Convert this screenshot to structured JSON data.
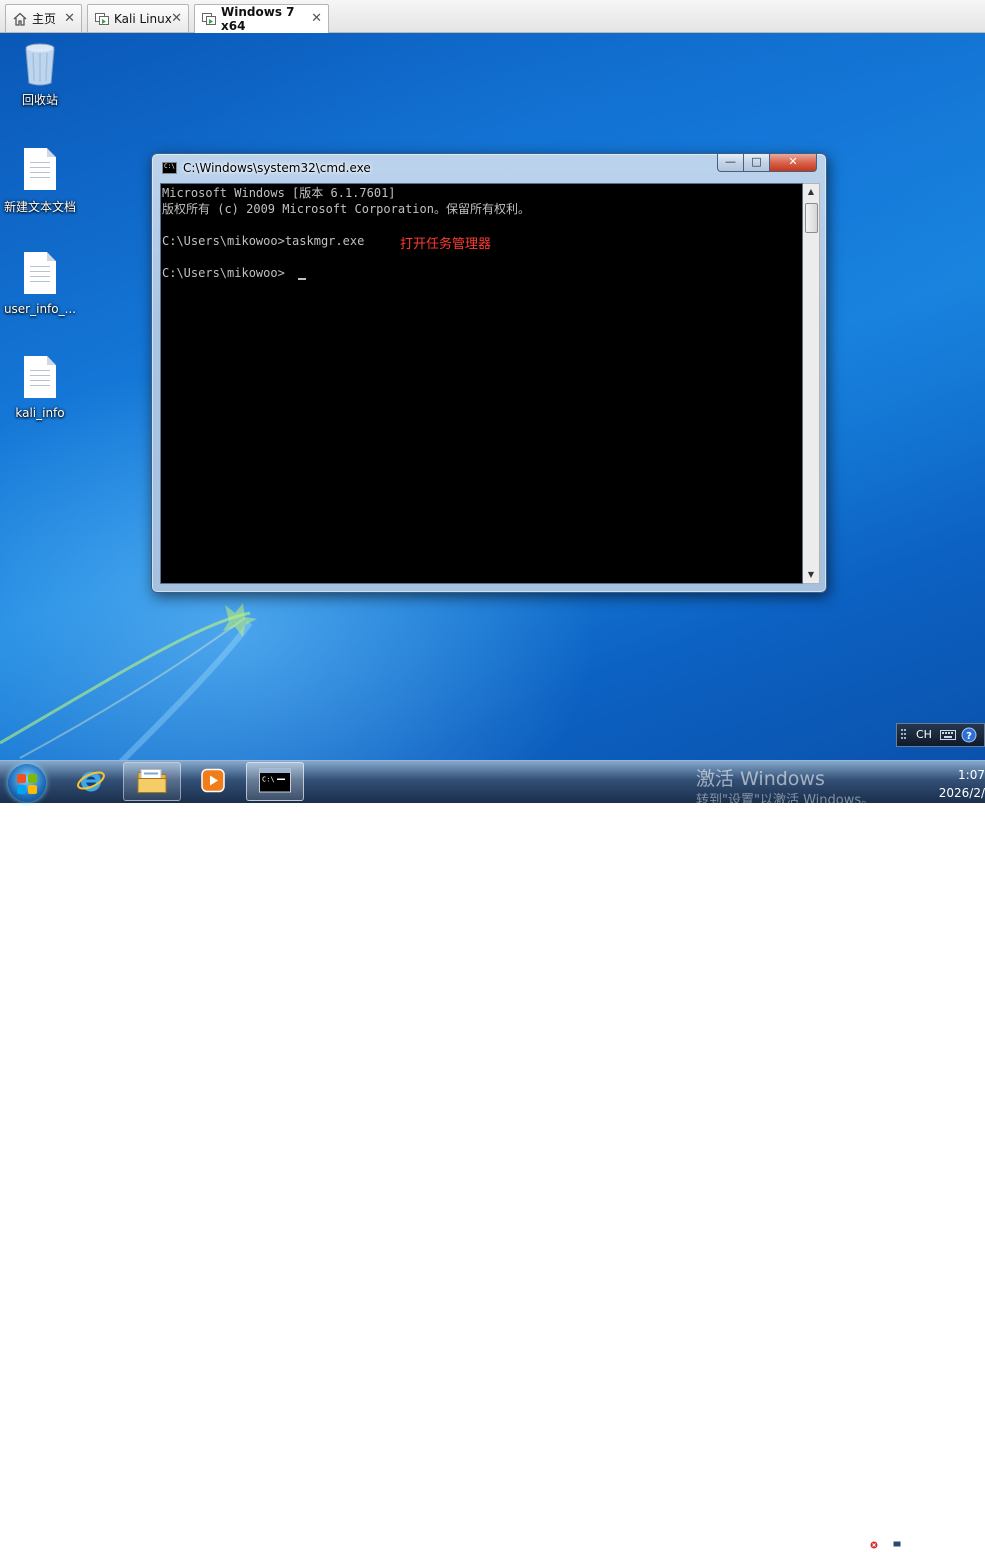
{
  "tabs": [
    {
      "label": "主页",
      "icon": "home-icon",
      "active": false
    },
    {
      "label": "Kali Linux",
      "icon": "vm-icon",
      "active": false
    },
    {
      "label": "Windows 7 x64",
      "icon": "vm-icon",
      "active": true
    }
  ],
  "desktop": {
    "icons": [
      {
        "label": "回收站",
        "icon": "recycle-bin-icon"
      },
      {
        "label": "新建文本文档",
        "icon": "text-document-icon"
      },
      {
        "label": "user_info_...",
        "icon": "text-document-icon"
      },
      {
        "label": "kali_info",
        "icon": "text-document-icon"
      }
    ]
  },
  "cmd": {
    "title": "C:\\Windows\\system32\\cmd.exe",
    "buttons": {
      "minimize": "—",
      "maximize": "□",
      "close": "✕"
    },
    "lines": [
      "Microsoft Windows [版本 6.1.7601]",
      "版权所有 (c) 2009 Microsoft Corporation。保留所有权利。",
      "",
      "C:\\Users\\mikowoo>taskmgr.exe",
      "",
      "C:\\Users\\mikowoo>"
    ],
    "annotation": "打开任务管理器",
    "annotation_color": "#ff3b30"
  },
  "langbar": {
    "lang": "CH"
  },
  "taskbar": {
    "watermark_title": "激活 Windows",
    "watermark_sub": "转到\"设置\"以激活 Windows。",
    "clock_time": "1:07",
    "clock_date": "2026/2/"
  },
  "colors": {
    "desktop_blue": "#1476d6",
    "console_bg": "#000000",
    "console_text": "#c0c0c0"
  }
}
